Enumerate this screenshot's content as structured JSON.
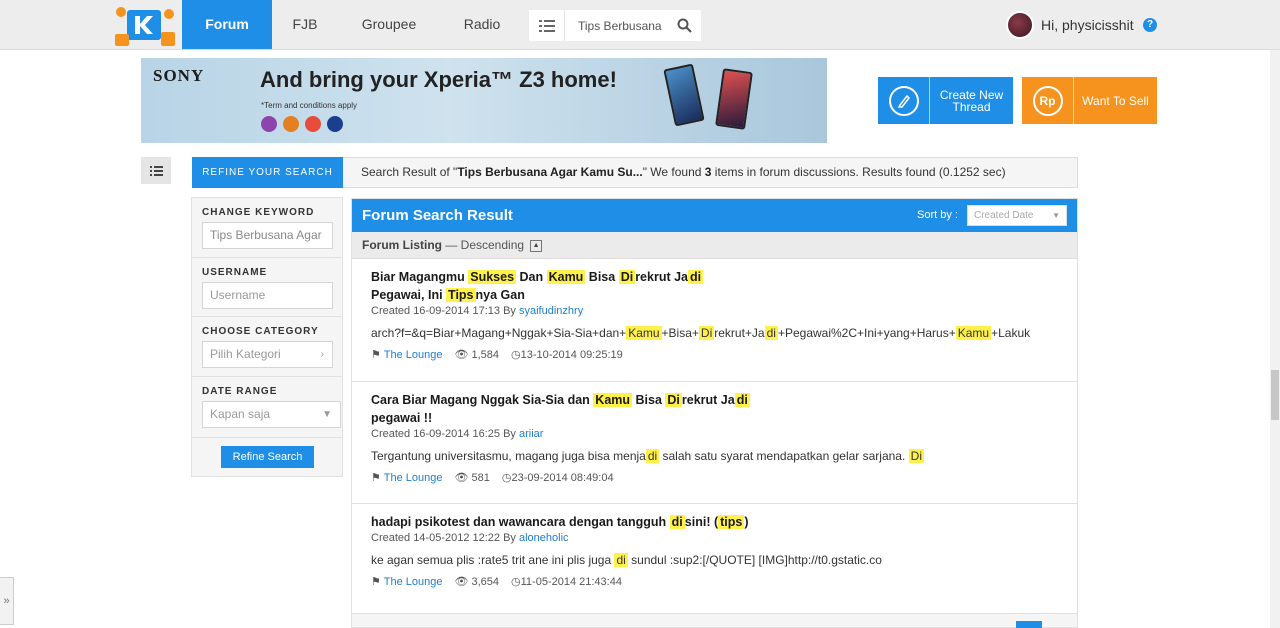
{
  "nav": {
    "items": [
      "Forum",
      "FJB",
      "Groupee",
      "Radio"
    ],
    "search_value": "Tips Berbusana",
    "greeting": "Hi, physicisshit",
    "help": "?"
  },
  "banner": {
    "brand": "SONY",
    "headline": "And bring your Xperia™ Z3 home!",
    "terms": "*Term and conditions apply"
  },
  "actions": {
    "create_line1": "Create New",
    "create_line2": "Thread",
    "sell": "Want To Sell",
    "sell_icon": "Rp"
  },
  "refine": {
    "tab": "REFINE YOUR SEARCH",
    "result_prefix": "Search Result of \"",
    "query": "Tips Berbusana Agar Kamu Su...",
    "result_mid": "\" We found ",
    "count": "3",
    "result_suffix": " items in forum discussions. Results found (0.1252 sec)"
  },
  "sidebar": {
    "keyword_label": "CHANGE KEYWORD",
    "keyword_value": "Tips Berbusana Agar",
    "username_label": "USERNAME",
    "username_placeholder": "Username",
    "category_label": "CHOOSE CATEGORY",
    "category_placeholder": "Pilih Kategori",
    "date_label": "DATE RANGE",
    "date_value": "Kapan saja",
    "button": "Refine Search"
  },
  "results": {
    "title": "Forum Search Result",
    "sort_label": "Sort by :",
    "sort_value": "Created Date",
    "listing": "Forum Listing",
    "order": " — Descending",
    "items": [
      {
        "title_line1": [
          {
            "t": "Biar Magangmu "
          },
          {
            "t": "Sukses",
            "h": true
          },
          {
            "t": " Dan "
          },
          {
            "t": "Kamu",
            "h": true
          },
          {
            "t": " Bisa "
          },
          {
            "t": "Di",
            "h": true
          },
          {
            "t": "rekrut Ja"
          },
          {
            "t": "di",
            "h": true
          }
        ],
        "title_line2": [
          {
            "t": "Pegawai, Ini "
          },
          {
            "t": "Tips",
            "h": true
          },
          {
            "t": "nya Gan"
          }
        ],
        "created": "Created 16-09-2014 17:13 By ",
        "author": "syaifudinzhry",
        "snippet": [
          {
            "t": "arch?f=&q=Biar+Magang+Nggak+Sia-Sia+dan+"
          },
          {
            "t": "Kamu",
            "h": true
          },
          {
            "t": "+Bisa+"
          },
          {
            "t": "Di",
            "h": true
          },
          {
            "t": "rekrut+Ja"
          },
          {
            "t": "di",
            "h": true
          },
          {
            "t": "+Pegawai%2C+Ini+yang+Harus+"
          },
          {
            "t": "Kamu",
            "h": true
          },
          {
            "t": "+Lakuk"
          }
        ],
        "forum": "The Lounge",
        "views": "1,584",
        "last": "13-10-2014 09:25:19"
      },
      {
        "title_line1": [
          {
            "t": "Cara Biar Magang Nggak Sia-Sia dan "
          },
          {
            "t": "Kamu",
            "h": true
          },
          {
            "t": " Bisa "
          },
          {
            "t": "Di",
            "h": true
          },
          {
            "t": "rekrut Ja"
          },
          {
            "t": "di",
            "h": true
          }
        ],
        "title_line2": [
          {
            "t": "pegawai !!"
          }
        ],
        "created": "Created 16-09-2014 16:25 By ",
        "author": "ariiar",
        "snippet": [
          {
            "t": "Tergantung universitasmu, magang juga bisa menja"
          },
          {
            "t": "di",
            "h": true
          },
          {
            "t": " salah satu syarat mendapatkan gelar sarjana. "
          },
          {
            "t": "Di",
            "h": true
          }
        ],
        "forum": "The Lounge",
        "views": "581",
        "last": "23-09-2014 08:49:04"
      },
      {
        "title_line1": [
          {
            "t": "hadapi psikotest dan wawancara dengan tangguh "
          },
          {
            "t": "di",
            "h": true
          },
          {
            "t": "sini! ("
          },
          {
            "t": "tips",
            "h": true
          },
          {
            "t": ")"
          }
        ],
        "title_line2": [],
        "created": "Created 14-05-2012 12:22 By ",
        "author": "aloneholic",
        "snippet": [
          {
            "t": "ke agan semua plis :rate5 trit ane ini plis juga "
          },
          {
            "t": "di",
            "h": true
          },
          {
            "t": " sundul :sup2:[/QUOTE] [IMG]http://t0.gstatic.co"
          }
        ],
        "forum": "The Lounge",
        "views": "3,654",
        "last": "11-05-2014 21:43:44"
      }
    ]
  },
  "colors": {
    "accent": "#1e8ee6",
    "orange": "#f6931f",
    "highlight": "#fff04a"
  }
}
